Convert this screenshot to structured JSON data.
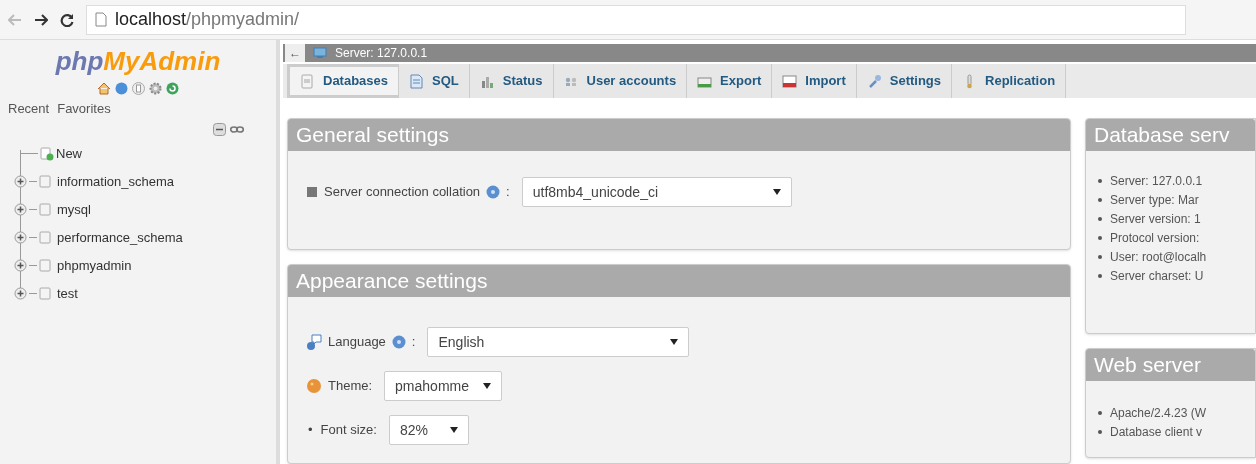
{
  "browser": {
    "url_host": "localhost",
    "url_path": "/phpmyadmin/"
  },
  "sidebar": {
    "logo_left": "php",
    "logo_right": "MyAdmin",
    "links": [
      "Recent",
      "Favorites"
    ],
    "tree": [
      {
        "kind": "new",
        "label": "New"
      },
      {
        "kind": "database",
        "label": "information_schema",
        "expanded": false
      },
      {
        "kind": "database",
        "label": "mysql",
        "expanded": false
      },
      {
        "kind": "database",
        "label": "performance_schema",
        "expanded": false
      },
      {
        "kind": "database",
        "label": "phpmyadmin",
        "expanded": false
      },
      {
        "kind": "database",
        "label": "test",
        "expanded": false
      }
    ]
  },
  "breadcrumb": {
    "collapse": "←",
    "server": "Server: 127.0.0.1"
  },
  "tabs": [
    {
      "label": "Databases",
      "selected": true
    },
    {
      "label": "SQL",
      "selected": false
    },
    {
      "label": "Status",
      "selected": false
    },
    {
      "label": "User accounts",
      "selected": false
    },
    {
      "label": "Export",
      "selected": false
    },
    {
      "label": "Import",
      "selected": false
    },
    {
      "label": "Settings",
      "selected": false
    },
    {
      "label": "Replication",
      "selected": false
    }
  ],
  "panels": [
    {
      "title": "General settings",
      "rows": [
        {
          "kind": "setting",
          "label": "Server connection collation",
          "help": true,
          "suffix": ":",
          "value": "utf8mb4_unicode_ci"
        }
      ]
    },
    {
      "title": "Appearance settings",
      "rows": [
        {
          "kind": "setting",
          "label": "Language",
          "help": true,
          "suffix": ":",
          "value": "English"
        },
        {
          "kind": "setting",
          "label": "Theme:",
          "help": false,
          "value": "pmahomme"
        },
        {
          "kind": "bullet",
          "bullet": "•",
          "label": "Font size:",
          "help": false,
          "value": "82%"
        }
      ]
    }
  ],
  "side_panels": [
    {
      "title": "Database serv",
      "items": [
        "Server: 127.0.0.1",
        "Server type: Mar",
        "Server version: 1",
        "Protocol version:",
        "User: root@localh",
        "Server charset: U"
      ]
    },
    {
      "title": "Web server",
      "items": [
        "Apache/2.4.23 (W",
        "Database client v"
      ]
    }
  ]
}
